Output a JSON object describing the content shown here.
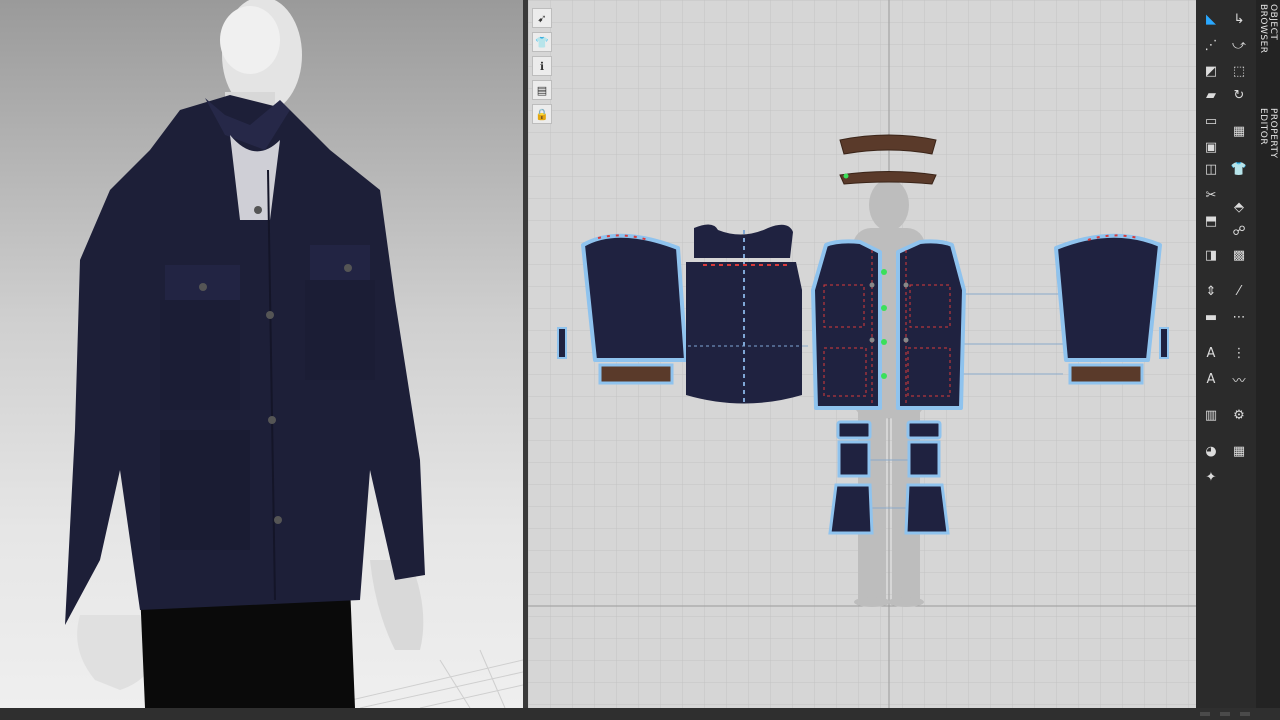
{
  "side_tabs": {
    "object_browser": "OBJECT BROWSER",
    "property_editor": "PROPERTY EDITOR"
  },
  "colors": {
    "garment_fill": "#1f2240",
    "piece_outline": "#8fc3ee",
    "collar_brown": "#5a3a2a",
    "seam_dash": "#7fa7d6",
    "notch_red": "#d83a3a",
    "button_green": "#3be05a",
    "grid_bg": "#d6d6d6",
    "toolbar_bg": "#2b2b2b"
  },
  "toolbar_icons": [
    "transform-pattern-icon",
    "edit-pattern-icon",
    "draw-polygon-icon",
    "draw-rectangle-icon",
    "internal-polygon-icon",
    "internal-rectangle-icon",
    "sewing-segment-icon",
    "free-sewing-icon",
    "fold-arrangement-icon",
    "edit-curvature-icon",
    "trace-icon",
    "add-text-icon",
    "grading-icon",
    "button-tool-icon",
    "topstitch-icon",
    "puckering-icon"
  ],
  "viewport_tools": [
    "select-tool-icon",
    "garment-icon",
    "info-icon",
    "fabric-icon",
    "lock-icon"
  ]
}
